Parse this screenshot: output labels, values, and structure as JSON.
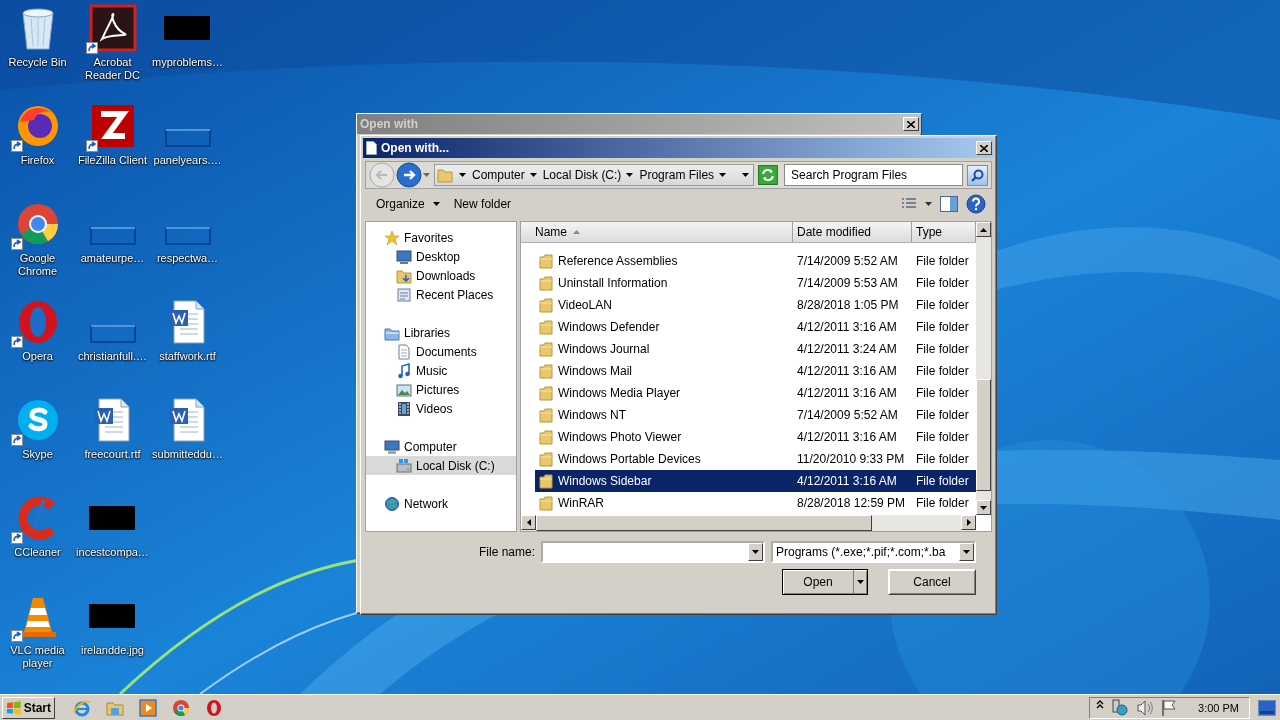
{
  "desktop": {
    "icons": [
      {
        "label": "Recycle Bin",
        "kind": "recycle",
        "shortcut": false
      },
      {
        "label": "Firefox",
        "kind": "firefox",
        "shortcut": true
      },
      {
        "label": "Google\nChrome",
        "kind": "chrome",
        "shortcut": true
      },
      {
        "label": "Opera",
        "kind": "opera",
        "shortcut": true
      },
      {
        "label": "Skype",
        "kind": "skype",
        "shortcut": true
      },
      {
        "label": "CCleaner",
        "kind": "ccleaner",
        "shortcut": true
      },
      {
        "label": "VLC media\nplayer",
        "kind": "vlc",
        "shortcut": true
      },
      {
        "label": "Acrobat\nReader DC",
        "kind": "acrobat",
        "shortcut": true
      },
      {
        "label": "FileZilla Client",
        "kind": "filezilla",
        "shortcut": true
      },
      {
        "label": "amateurpe…",
        "kind": "blank",
        "shortcut": false
      },
      {
        "label": "christianfull.…",
        "kind": "blank",
        "shortcut": false
      },
      {
        "label": "freecourt.rtf",
        "kind": "word",
        "shortcut": false
      },
      {
        "label": "incestcompa…",
        "kind": "redacted",
        "shortcut": false
      },
      {
        "label": "irelandde.jpg",
        "kind": "redacted",
        "shortcut": false
      },
      {
        "label": "myproblems…",
        "kind": "redacted",
        "shortcut": false
      },
      {
        "label": "panelyears.…",
        "kind": "blank",
        "shortcut": false
      },
      {
        "label": "respectwa…",
        "kind": "blank",
        "shortcut": false
      },
      {
        "label": "staffwork.rtf",
        "kind": "word",
        "shortcut": false
      },
      {
        "label": "submitteddu…",
        "kind": "word",
        "shortcut": false
      }
    ]
  },
  "back_window": {
    "title": "Open with",
    "active": false
  },
  "dialog": {
    "title": "Open with...",
    "active": true,
    "address": {
      "path": [
        "Computer",
        "Local Disk (C:)",
        "Program Files"
      ]
    },
    "search": {
      "placeholder": "Search Program Files"
    },
    "toolbar": {
      "organize": "Organize",
      "new_folder": "New folder"
    },
    "nav": [
      {
        "label": "Favorites",
        "kind": "star",
        "selected": false,
        "children": [
          {
            "label": "Desktop",
            "kind": "desktop",
            "selected": false
          },
          {
            "label": "Downloads",
            "kind": "downloads",
            "selected": false
          },
          {
            "label": "Recent Places",
            "kind": "recent",
            "selected": false
          }
        ]
      },
      {
        "label": "Libraries",
        "kind": "libraries",
        "selected": false,
        "children": [
          {
            "label": "Documents",
            "kind": "documents",
            "selected": false
          },
          {
            "label": "Music",
            "kind": "music",
            "selected": false
          },
          {
            "label": "Pictures",
            "kind": "pictures",
            "selected": false
          },
          {
            "label": "Videos",
            "kind": "videos",
            "selected": false
          }
        ]
      },
      {
        "label": "Computer",
        "kind": "computer",
        "selected": false,
        "children": [
          {
            "label": "Local Disk (C:)",
            "kind": "disk",
            "selected": true
          }
        ]
      },
      {
        "label": "Network",
        "kind": "network",
        "selected": false
      }
    ],
    "table": {
      "columns": [
        {
          "label": "Name",
          "sorted": true
        },
        {
          "label": "Date modified",
          "sorted": false
        },
        {
          "label": "Type",
          "sorted": false
        }
      ],
      "rows": [
        {
          "name": "Reference Assemblies",
          "date": "7/14/2009 5:52 AM",
          "type": "File folder",
          "selected": false
        },
        {
          "name": "Uninstall Information",
          "date": "7/14/2009 5:53 AM",
          "type": "File folder",
          "selected": false
        },
        {
          "name": "VideoLAN",
          "date": "8/28/2018 1:05 PM",
          "type": "File folder",
          "selected": false
        },
        {
          "name": "Windows Defender",
          "date": "4/12/2011 3:16 AM",
          "type": "File folder",
          "selected": false
        },
        {
          "name": "Windows Journal",
          "date": "4/12/2011 3:24 AM",
          "type": "File folder",
          "selected": false
        },
        {
          "name": "Windows Mail",
          "date": "4/12/2011 3:16 AM",
          "type": "File folder",
          "selected": false
        },
        {
          "name": "Windows Media Player",
          "date": "4/12/2011 3:16 AM",
          "type": "File folder",
          "selected": false
        },
        {
          "name": "Windows NT",
          "date": "7/14/2009 5:52 AM",
          "type": "File folder",
          "selected": false
        },
        {
          "name": "Windows Photo Viewer",
          "date": "4/12/2011 3:16 AM",
          "type": "File folder",
          "selected": false
        },
        {
          "name": "Windows Portable Devices",
          "date": "11/20/2010 9:33 PM",
          "type": "File folder",
          "selected": false
        },
        {
          "name": "Windows Sidebar",
          "date": "4/12/2011 3:16 AM",
          "type": "File folder",
          "selected": true
        },
        {
          "name": "WinRAR",
          "date": "8/28/2018 12:59 PM",
          "type": "File folder",
          "selected": false
        }
      ]
    },
    "file_name": {
      "label": "File name:"
    },
    "file_type": {
      "value": "Programs (*.exe;*.pif;*.com;*.ba"
    },
    "buttons": [
      {
        "label": "Open",
        "kind": "split"
      },
      {
        "label": "Cancel",
        "kind": "plain"
      }
    ]
  },
  "taskbar": {
    "start": "Start",
    "apps": [
      {
        "kind": "ie"
      },
      {
        "kind": "explorer"
      },
      {
        "kind": "media"
      },
      {
        "kind": "chrome"
      },
      {
        "kind": "opera"
      }
    ],
    "tray": [
      {
        "kind": "chevron"
      },
      {
        "kind": "network"
      },
      {
        "kind": "volume"
      },
      {
        "kind": "flag"
      }
    ],
    "clock": "3:00 PM"
  }
}
